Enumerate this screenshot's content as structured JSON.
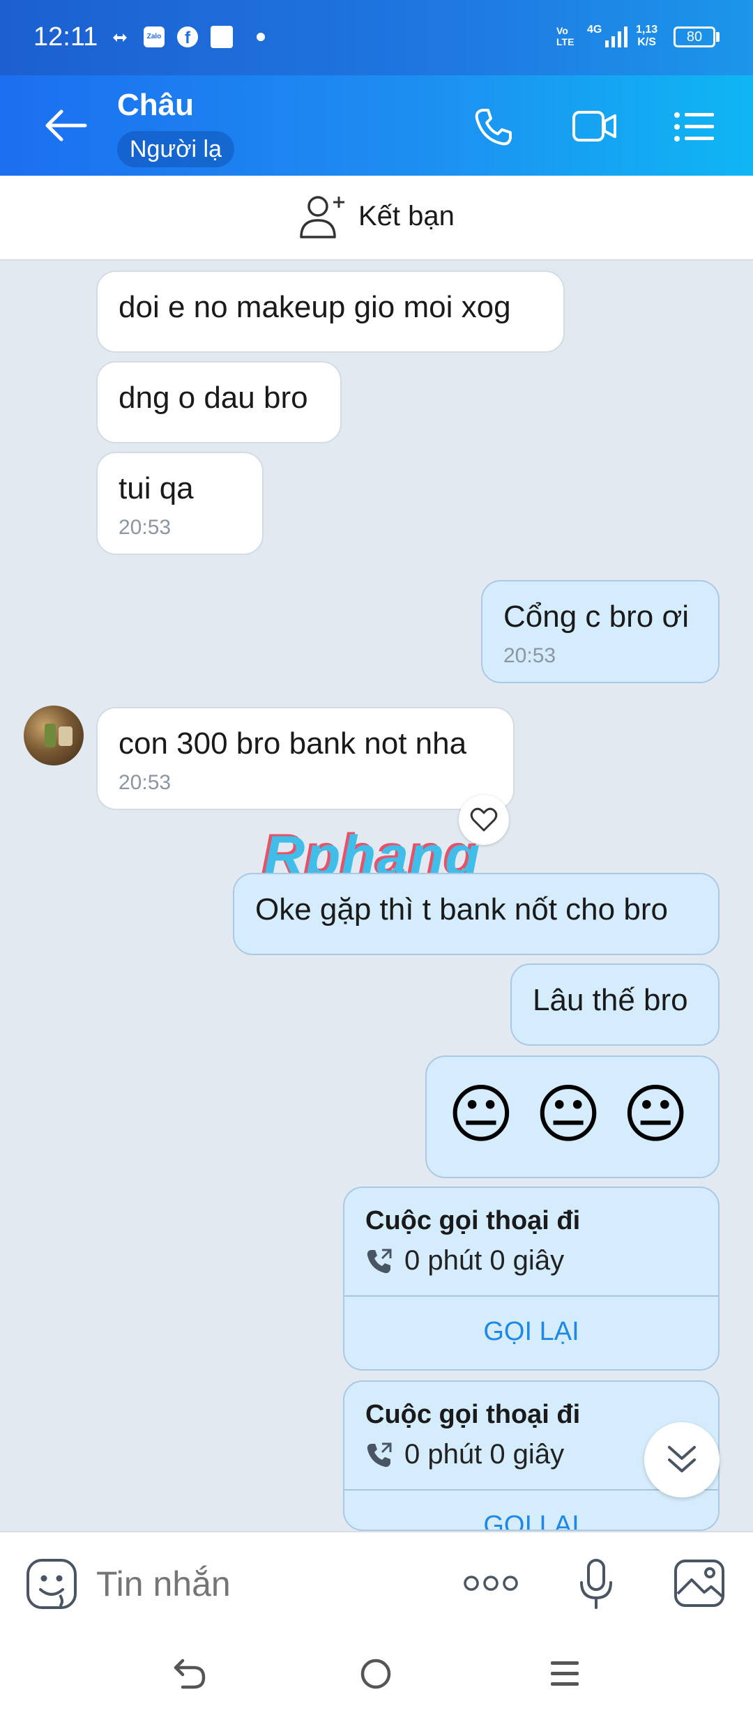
{
  "status_bar": {
    "time": "12:11",
    "net_type": "4G",
    "volte": "Vo\nLTE",
    "speed_top": "1,13",
    "speed_bottom": "K/S",
    "battery": "80"
  },
  "header": {
    "contact_name": "Châu",
    "contact_tag": "Người lạ"
  },
  "add_friend": {
    "label": "Kết bạn"
  },
  "messages": [
    {
      "dir": "in",
      "text": "doi e no makeup gio moi xog"
    },
    {
      "dir": "in",
      "text": "dng o dau bro"
    },
    {
      "dir": "in",
      "text": "tui qa",
      "time": "20:53"
    },
    {
      "dir": "out",
      "text": "Cổng c bro ơi",
      "time": "20:53"
    },
    {
      "dir": "in",
      "text": "con 300 bro bank not nha",
      "time": "20:53"
    },
    {
      "dir": "out",
      "text": "Oke gặp thì t bank nốt cho bro"
    },
    {
      "dir": "out",
      "text": "Lâu thế bro"
    },
    {
      "dir": "out",
      "text": "😐 😐 😐"
    }
  ],
  "calls": [
    {
      "title": "Cuộc gọi thoại đi",
      "duration": "0 phút 0 giây",
      "action": "GỌI LẠI"
    },
    {
      "title": "Cuộc gọi thoại đi",
      "duration": "0 phút 0 giây",
      "action": "GỌI LẠI"
    }
  ],
  "watermark": "Rphang",
  "composer": {
    "placeholder": "Tin nhắn"
  },
  "colors": {
    "header_gradient_start": "#1c6ff0",
    "header_gradient_end": "#0fb6f4",
    "chat_background": "#e2e9f1",
    "outgoing_bubble": "#d5ecfc",
    "incoming_bubble": "#ffffff",
    "accent": "#1e88e5"
  },
  "icons": {
    "status": [
      "sync-icon",
      "zalo-icon",
      "facebook-icon",
      "notification-square-icon",
      "dot-icon",
      "signal-icon",
      "battery-icon"
    ],
    "header": [
      "back-arrow-icon",
      "phone-icon",
      "video-call-icon",
      "list-menu-icon"
    ],
    "composer": [
      "sticker-icon",
      "more-icon",
      "microphone-icon",
      "gallery-icon"
    ],
    "nav": [
      "back-nav-icon",
      "home-nav-icon",
      "recents-nav-icon"
    ]
  }
}
